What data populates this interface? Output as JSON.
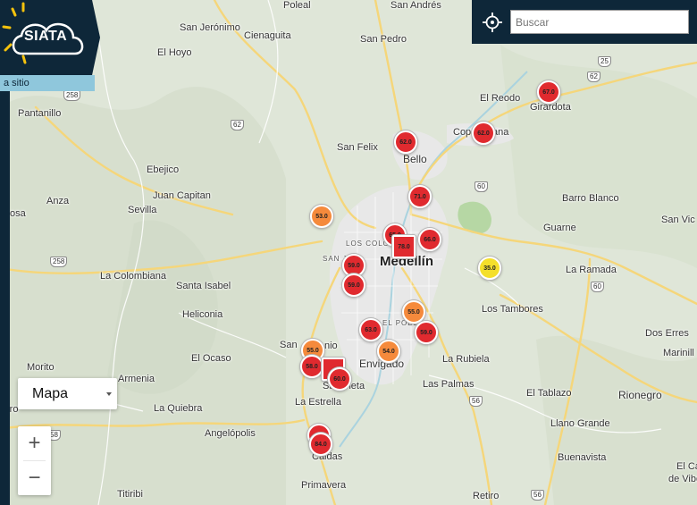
{
  "header": {
    "logo_text": "SIATA",
    "site_link": "a sitio"
  },
  "search": {
    "placeholder": "Buscar"
  },
  "controls": {
    "map_type": "Mapa",
    "zoom_in": "+",
    "zoom_out": "−"
  },
  "colors": {
    "red": "#e02a2f",
    "orange": "#f58a3c",
    "yellow": "#f4df2a",
    "navy": "#0e2739",
    "light_blue": "#8fc7dc"
  },
  "places": [
    "Poleal",
    "San Andrés",
    "San Jerónimo",
    "Cienaguita",
    "San Pedro",
    "El Hoyo",
    "Pantanillo",
    "El Reodo",
    "Girardota",
    "Copacabana",
    "San Felix",
    "Bello",
    "Ebejico",
    "Juan Capitan",
    "Sevilla",
    "Anza",
    "osa",
    "Barro Blanco",
    "Guarne",
    "San Vic",
    "LOS COLO",
    "SAN JA",
    "Medellín",
    "La Ramada",
    "La Colombiana",
    "Santa Isabel",
    "Heliconia",
    "EL POBL",
    "Los Tambores",
    "Dos Erres",
    "San",
    "nio",
    "El Ocaso",
    "Envigado",
    "La Rubiela",
    "Marinill",
    "Morito",
    "Armenia",
    "Sabaneta",
    "Las Palmas",
    "El Tablazo",
    "Rionegro",
    "rro",
    "La Estrella",
    "La Quiebra",
    "Llano Grande",
    "Angelópolis",
    "Caldas",
    "Buenavista",
    "El Ca",
    "de Vibo",
    "Titiribi",
    "Primavera",
    "Retiro"
  ],
  "road_shields": [
    "25",
    "62",
    "62",
    "258",
    "62",
    "60",
    "60",
    "258",
    "60",
    "56",
    "58",
    "56"
  ],
  "stations": [
    {
      "value": "67.0",
      "level": "red"
    },
    {
      "value": "62.0",
      "level": "red"
    },
    {
      "value": "62.0",
      "level": "red"
    },
    {
      "value": "71.0",
      "level": "red"
    },
    {
      "value": "53.0",
      "level": "orange"
    },
    {
      "value": "65.0",
      "level": "red"
    },
    {
      "value": "78.0",
      "level": "red"
    },
    {
      "value": "66.0",
      "level": "red"
    },
    {
      "value": "35.0",
      "level": "yellow"
    },
    {
      "value": "59.0",
      "level": "red"
    },
    {
      "value": "59.0",
      "level": "red"
    },
    {
      "value": "55.0",
      "level": "orange"
    },
    {
      "value": "63.0",
      "level": "red"
    },
    {
      "value": "59.0",
      "level": "red"
    },
    {
      "value": "54.0",
      "level": "orange"
    },
    {
      "value": "55.0",
      "level": "orange"
    },
    {
      "value": "58.0",
      "level": "red"
    },
    {
      "value": "",
      "level": "red"
    },
    {
      "value": "60.0",
      "level": "red"
    },
    {
      "value": "",
      "level": "red"
    },
    {
      "value": "84.0",
      "level": "red"
    }
  ]
}
